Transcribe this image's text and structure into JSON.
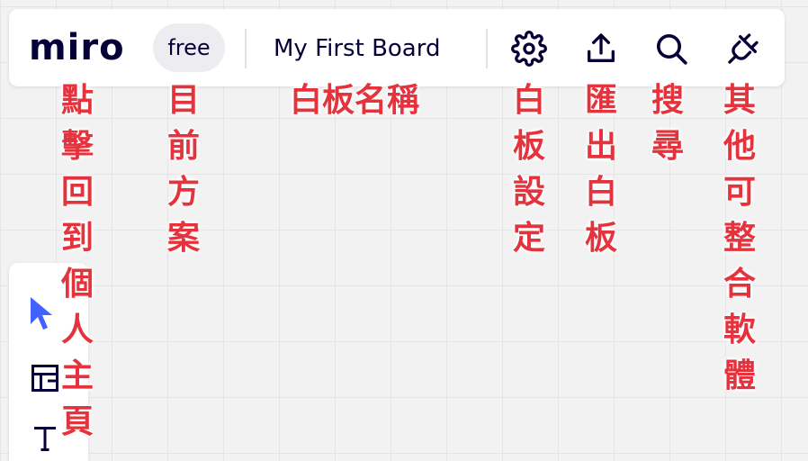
{
  "header": {
    "logo": "miro",
    "plan_badge": "free",
    "board_name": "My First Board",
    "tools": [
      "gear-icon",
      "upload-icon",
      "search-icon",
      "plug-icon"
    ]
  },
  "sidebar": {
    "tools": [
      "cursor-icon",
      "frame-icon",
      "text-icon"
    ]
  },
  "annotations": {
    "home": "點擊回到個人主頁",
    "plan": "目前方案",
    "board_name": "白板名稱",
    "settings": "白板設定",
    "export": "匯出白板",
    "search": "搜尋",
    "integrations": "其他可整合軟體"
  },
  "colors": {
    "brand_text": "#050038",
    "annotation": "#e5333d",
    "cursor": "#4262ff"
  }
}
